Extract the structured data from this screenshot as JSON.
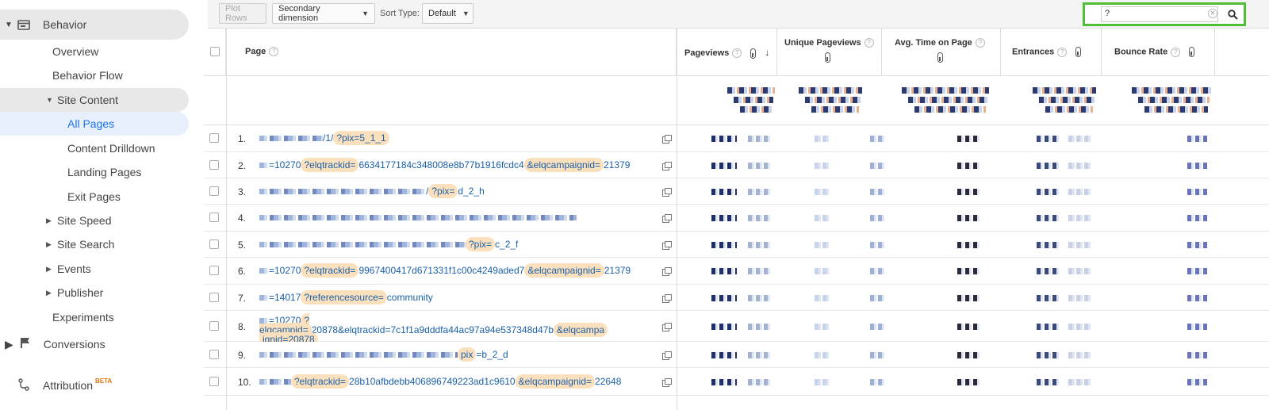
{
  "sidebar": {
    "behavior": "Behavior",
    "overview": "Overview",
    "behavior_flow": "Behavior Flow",
    "site_content": "Site Content",
    "all_pages": "All Pages",
    "content_drilldown": "Content Drilldown",
    "landing_pages": "Landing Pages",
    "exit_pages": "Exit Pages",
    "site_speed": "Site Speed",
    "site_search": "Site Search",
    "events": "Events",
    "publisher": "Publisher",
    "experiments": "Experiments",
    "conversions": "Conversions",
    "attribution": "Attribution",
    "beta": "BETA"
  },
  "toolbar": {
    "plot_rows": "Plot Rows",
    "secondary_dimension": "Secondary dimension",
    "sort_type_label": "Sort Type:",
    "sort_type_value": "Default",
    "search_value": "?"
  },
  "table": {
    "headers": {
      "page": "Page",
      "pageviews": "Pageviews",
      "unique_pageviews": "Unique Pageviews",
      "avg_time": "Avg. Time on Page",
      "entrances": "Entrances",
      "bounce_rate": "Bounce Rate"
    },
    "rows": [
      {
        "num": "1.",
        "segments": [
          {
            "t": "/1/"
          },
          {
            "t": "?pix=5_1_1",
            "h": true
          }
        ]
      },
      {
        "num": "2.",
        "segments": [
          {
            "t": "=10270"
          },
          {
            "t": "?elqtrackid=",
            "h": true
          },
          {
            "t": "6634177184c348008e8b77b1916fcdc4"
          },
          {
            "t": "&elqcampaignid=",
            "h": true
          },
          {
            "t": "21379"
          }
        ]
      },
      {
        "num": "3.",
        "segments": [
          {
            "t": "/"
          },
          {
            "t": "?pix=",
            "h": true
          },
          {
            "t": "d_2_h"
          }
        ]
      },
      {
        "num": "4.",
        "segments": []
      },
      {
        "num": "5.",
        "segments": [
          {
            "t": "?pix=",
            "h": true
          },
          {
            "t": "c_2_f"
          }
        ]
      },
      {
        "num": "6.",
        "segments": [
          {
            "t": "=10270"
          },
          {
            "t": "?elqtrackid=",
            "h": true
          },
          {
            "t": "9967400417d671331f1c00c4249aded7"
          },
          {
            "t": "&elqcampaignid=",
            "h": true
          },
          {
            "t": "21379"
          }
        ]
      },
      {
        "num": "7.",
        "segments": [
          {
            "t": "=14017"
          },
          {
            "t": "?referencesource=",
            "h": true
          },
          {
            "t": "community"
          }
        ]
      },
      {
        "num": "8.",
        "segments": [
          {
            "t": "=10270"
          },
          {
            "t": "?elqcampid=",
            "h": true
          },
          {
            "t": "20878&elqtrackid=7c1f1a9dddfa44ac97a94e537348d47b"
          },
          {
            "t": "&elqcampa",
            "h": true
          },
          {
            "t": "ignid=20878",
            "h": true,
            "br": true
          }
        ]
      },
      {
        "num": "9.",
        "segments": [
          {
            "t": "pix",
            "h": true
          },
          {
            "t": "=b_2_d"
          }
        ]
      },
      {
        "num": "10.",
        "segments": [
          {
            "t": "?elqtrackid=",
            "h": true
          },
          {
            "t": "28b10afbdebb406896749223ad1c9610"
          },
          {
            "t": "&elqcampaignid=",
            "h": true
          },
          {
            "t": "22648"
          }
        ]
      }
    ]
  },
  "colors": {
    "highlight": "#fbe0bd",
    "link": "#1a5fa8",
    "search_border": "#4fbf36",
    "active_nav": "#1a73e8"
  },
  "icons": [
    "behavior-icon",
    "conversions-flag-icon",
    "attribution-icon",
    "search-icon",
    "clear-icon",
    "open-external-icon",
    "help-icon",
    "sort-down-icon",
    "thermometer-icon"
  ]
}
